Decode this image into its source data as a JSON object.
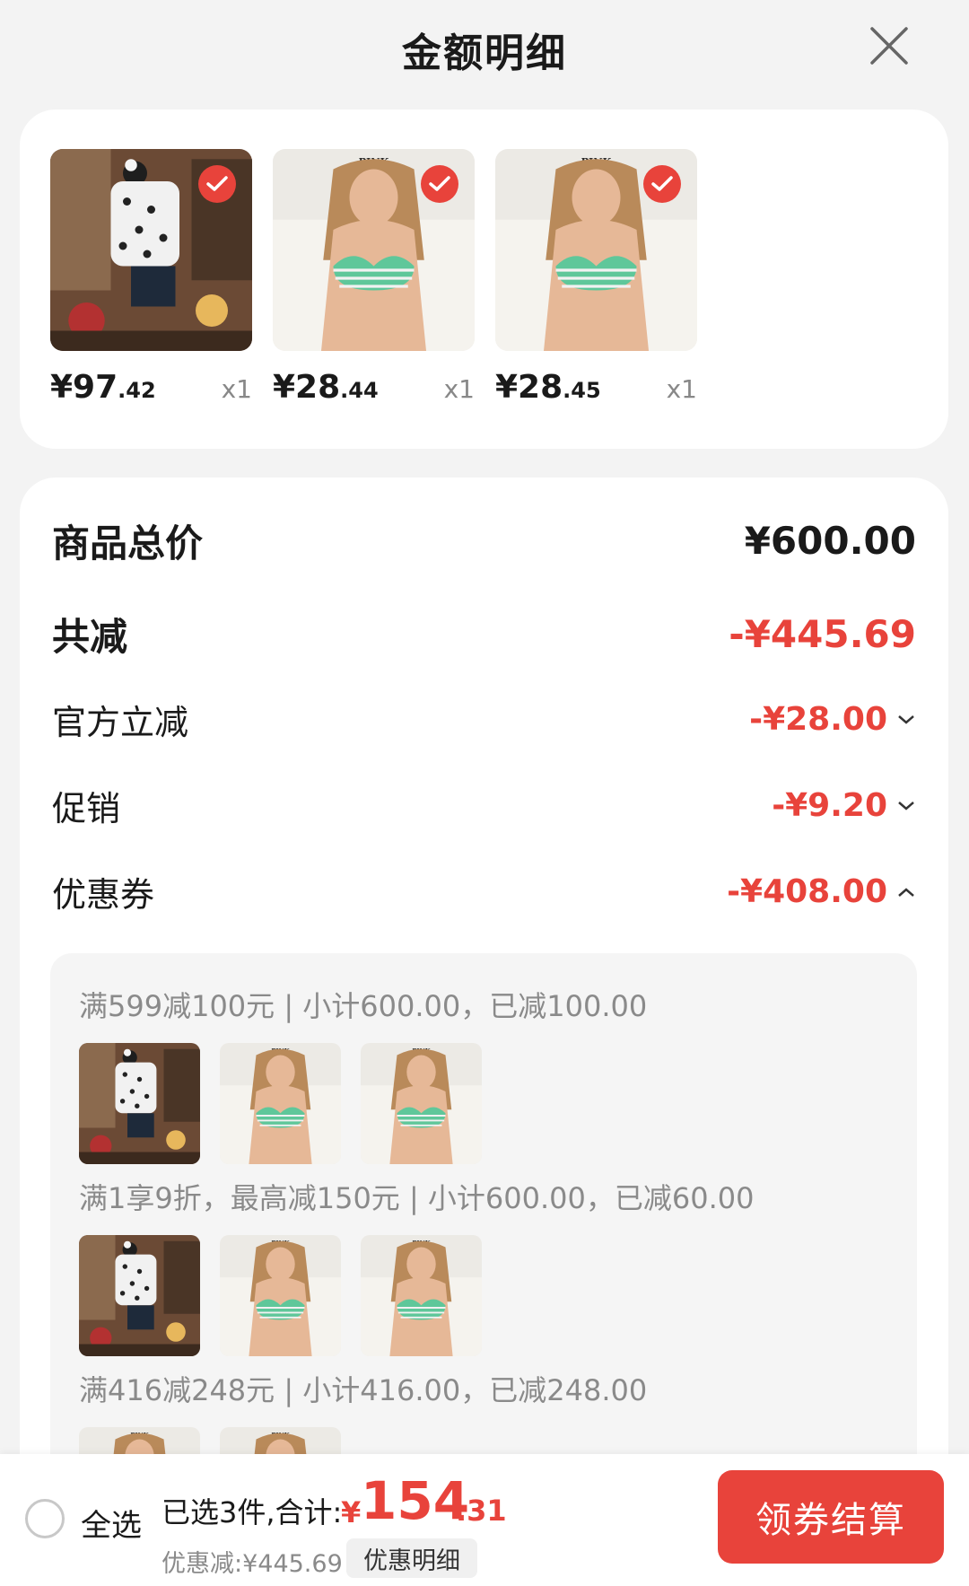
{
  "header": {
    "title": "金额明细"
  },
  "products": [
    {
      "price_int": "¥97",
      "price_dec": ".42",
      "qty": "x1",
      "image": "pajama-model"
    },
    {
      "price_int": "¥28",
      "price_dec": ".44",
      "qty": "x1",
      "image": "bra-model"
    },
    {
      "price_int": "¥28",
      "price_dec": ".45",
      "qty": "x1",
      "image": "bra-model"
    }
  ],
  "summary": {
    "total_label": "商品总价",
    "total_value": "¥600.00",
    "reduce_label": "共减",
    "reduce_value": "-¥445.69",
    "official_label": "官方立减",
    "official_value": "-¥28.00",
    "promo_label": "促销",
    "promo_value": "-¥9.20",
    "coupon_label": "优惠券",
    "coupon_value": "-¥408.00"
  },
  "coupons": [
    {
      "text": "满599减100元 | 小计600.00，已减100.00"
    },
    {
      "text": "满1享9折，最高减150元 | 小计600.00，已减60.00"
    },
    {
      "text": "满416减248元 | 小计416.00，已减248.00"
    }
  ],
  "bottom": {
    "select_all": "全选",
    "selected_text": "已选3件,合计:",
    "total_yen": "¥",
    "total_int": "154",
    "total_dec": ".31",
    "discount_text": "优惠减:¥445.69",
    "detail_btn": "优惠明细",
    "checkout_btn": "领券结算"
  },
  "colors": {
    "accent": "#e8433b",
    "check": "#e8433b"
  }
}
